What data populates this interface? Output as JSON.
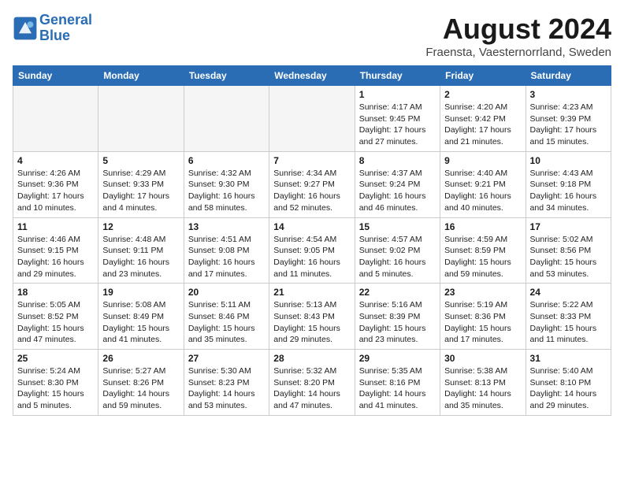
{
  "header": {
    "logo_line1": "General",
    "logo_line2": "Blue",
    "month_year": "August 2024",
    "location": "Fraensta, Vaesternorrland, Sweden"
  },
  "days_of_week": [
    "Sunday",
    "Monday",
    "Tuesday",
    "Wednesday",
    "Thursday",
    "Friday",
    "Saturday"
  ],
  "weeks": [
    [
      {
        "day": "",
        "detail": ""
      },
      {
        "day": "",
        "detail": ""
      },
      {
        "day": "",
        "detail": ""
      },
      {
        "day": "",
        "detail": ""
      },
      {
        "day": "1",
        "detail": "Sunrise: 4:17 AM\nSunset: 9:45 PM\nDaylight: 17 hours\nand 27 minutes."
      },
      {
        "day": "2",
        "detail": "Sunrise: 4:20 AM\nSunset: 9:42 PM\nDaylight: 17 hours\nand 21 minutes."
      },
      {
        "day": "3",
        "detail": "Sunrise: 4:23 AM\nSunset: 9:39 PM\nDaylight: 17 hours\nand 15 minutes."
      }
    ],
    [
      {
        "day": "4",
        "detail": "Sunrise: 4:26 AM\nSunset: 9:36 PM\nDaylight: 17 hours\nand 10 minutes."
      },
      {
        "day": "5",
        "detail": "Sunrise: 4:29 AM\nSunset: 9:33 PM\nDaylight: 17 hours\nand 4 minutes."
      },
      {
        "day": "6",
        "detail": "Sunrise: 4:32 AM\nSunset: 9:30 PM\nDaylight: 16 hours\nand 58 minutes."
      },
      {
        "day": "7",
        "detail": "Sunrise: 4:34 AM\nSunset: 9:27 PM\nDaylight: 16 hours\nand 52 minutes."
      },
      {
        "day": "8",
        "detail": "Sunrise: 4:37 AM\nSunset: 9:24 PM\nDaylight: 16 hours\nand 46 minutes."
      },
      {
        "day": "9",
        "detail": "Sunrise: 4:40 AM\nSunset: 9:21 PM\nDaylight: 16 hours\nand 40 minutes."
      },
      {
        "day": "10",
        "detail": "Sunrise: 4:43 AM\nSunset: 9:18 PM\nDaylight: 16 hours\nand 34 minutes."
      }
    ],
    [
      {
        "day": "11",
        "detail": "Sunrise: 4:46 AM\nSunset: 9:15 PM\nDaylight: 16 hours\nand 29 minutes."
      },
      {
        "day": "12",
        "detail": "Sunrise: 4:48 AM\nSunset: 9:11 PM\nDaylight: 16 hours\nand 23 minutes."
      },
      {
        "day": "13",
        "detail": "Sunrise: 4:51 AM\nSunset: 9:08 PM\nDaylight: 16 hours\nand 17 minutes."
      },
      {
        "day": "14",
        "detail": "Sunrise: 4:54 AM\nSunset: 9:05 PM\nDaylight: 16 hours\nand 11 minutes."
      },
      {
        "day": "15",
        "detail": "Sunrise: 4:57 AM\nSunset: 9:02 PM\nDaylight: 16 hours\nand 5 minutes."
      },
      {
        "day": "16",
        "detail": "Sunrise: 4:59 AM\nSunset: 8:59 PM\nDaylight: 15 hours\nand 59 minutes."
      },
      {
        "day": "17",
        "detail": "Sunrise: 5:02 AM\nSunset: 8:56 PM\nDaylight: 15 hours\nand 53 minutes."
      }
    ],
    [
      {
        "day": "18",
        "detail": "Sunrise: 5:05 AM\nSunset: 8:52 PM\nDaylight: 15 hours\nand 47 minutes."
      },
      {
        "day": "19",
        "detail": "Sunrise: 5:08 AM\nSunset: 8:49 PM\nDaylight: 15 hours\nand 41 minutes."
      },
      {
        "day": "20",
        "detail": "Sunrise: 5:11 AM\nSunset: 8:46 PM\nDaylight: 15 hours\nand 35 minutes."
      },
      {
        "day": "21",
        "detail": "Sunrise: 5:13 AM\nSunset: 8:43 PM\nDaylight: 15 hours\nand 29 minutes."
      },
      {
        "day": "22",
        "detail": "Sunrise: 5:16 AM\nSunset: 8:39 PM\nDaylight: 15 hours\nand 23 minutes."
      },
      {
        "day": "23",
        "detail": "Sunrise: 5:19 AM\nSunset: 8:36 PM\nDaylight: 15 hours\nand 17 minutes."
      },
      {
        "day": "24",
        "detail": "Sunrise: 5:22 AM\nSunset: 8:33 PM\nDaylight: 15 hours\nand 11 minutes."
      }
    ],
    [
      {
        "day": "25",
        "detail": "Sunrise: 5:24 AM\nSunset: 8:30 PM\nDaylight: 15 hours\nand 5 minutes."
      },
      {
        "day": "26",
        "detail": "Sunrise: 5:27 AM\nSunset: 8:26 PM\nDaylight: 14 hours\nand 59 minutes."
      },
      {
        "day": "27",
        "detail": "Sunrise: 5:30 AM\nSunset: 8:23 PM\nDaylight: 14 hours\nand 53 minutes."
      },
      {
        "day": "28",
        "detail": "Sunrise: 5:32 AM\nSunset: 8:20 PM\nDaylight: 14 hours\nand 47 minutes."
      },
      {
        "day": "29",
        "detail": "Sunrise: 5:35 AM\nSunset: 8:16 PM\nDaylight: 14 hours\nand 41 minutes."
      },
      {
        "day": "30",
        "detail": "Sunrise: 5:38 AM\nSunset: 8:13 PM\nDaylight: 14 hours\nand 35 minutes."
      },
      {
        "day": "31",
        "detail": "Sunrise: 5:40 AM\nSunset: 8:10 PM\nDaylight: 14 hours\nand 29 minutes."
      }
    ]
  ]
}
